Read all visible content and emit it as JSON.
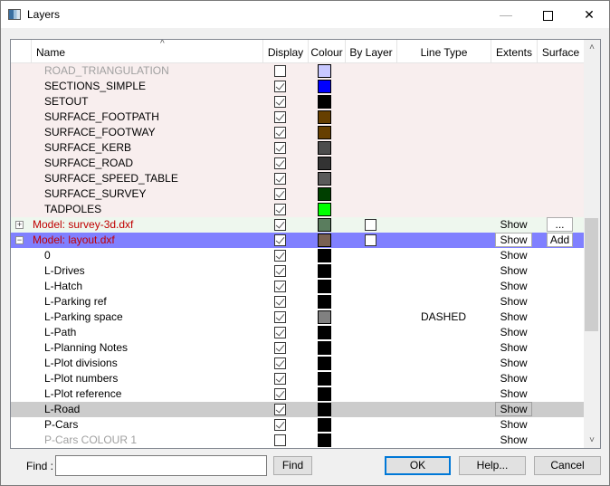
{
  "window": {
    "title": "Layers",
    "minimize_glyph": "—",
    "close_glyph": "✕",
    "app_icon": "layers-app-icon"
  },
  "columns": [
    {
      "key": "name",
      "label": "Name",
      "sorted": "ascending"
    },
    {
      "key": "display",
      "label": "Display"
    },
    {
      "key": "colour",
      "label": "Colour"
    },
    {
      "key": "bylayer",
      "label": "By Layer"
    },
    {
      "key": "linetype",
      "label": "Line Type"
    },
    {
      "key": "extents",
      "label": "Extents"
    },
    {
      "key": "surface",
      "label": "Surface"
    }
  ],
  "sort_glyph": "^",
  "rows": [
    {
      "type": "layer",
      "group": "pink",
      "name": "ROAD_TRIANGULATION",
      "dim": true,
      "display": false,
      "colour": "#c8c8ff"
    },
    {
      "type": "layer",
      "group": "pink",
      "name": "SECTIONS_SIMPLE",
      "display": true,
      "colour": "#0000ff"
    },
    {
      "type": "layer",
      "group": "pink",
      "name": "SETOUT",
      "display": true,
      "colour": "#000000"
    },
    {
      "type": "layer",
      "group": "pink",
      "name": "SURFACE_FOOTPATH",
      "display": true,
      "colour": "#663f00"
    },
    {
      "type": "layer",
      "group": "pink",
      "name": "SURFACE_FOOTWAY",
      "display": true,
      "colour": "#663f00"
    },
    {
      "type": "layer",
      "group": "pink",
      "name": "SURFACE_KERB",
      "display": true,
      "colour": "#4d4d4d"
    },
    {
      "type": "layer",
      "group": "pink",
      "name": "SURFACE_ROAD",
      "display": true,
      "colour": "#333333"
    },
    {
      "type": "layer",
      "group": "pink",
      "name": "SURFACE_SPEED_TABLE",
      "display": true,
      "colour": "#5a5a5a"
    },
    {
      "type": "layer",
      "group": "pink",
      "name": "SURFACE_SURVEY",
      "display": true,
      "colour": "#003f00"
    },
    {
      "type": "layer",
      "group": "pink",
      "name": "TADPOLES",
      "display": true,
      "colour": "#00ff00"
    },
    {
      "type": "model",
      "group": "green",
      "name": "Model: survey-3d.dxf",
      "expander": "+",
      "display": true,
      "colour": "#5a7d5e",
      "bylayer": false,
      "extents": "Show",
      "surface": "..."
    },
    {
      "type": "model",
      "group": "sel",
      "name": "Model: layout.dxf",
      "expander": "−",
      "display": true,
      "colour": "#7a6152",
      "bylayer": false,
      "extents": "Show",
      "extents_button": true,
      "surface": "Add"
    },
    {
      "type": "layer",
      "name": "0",
      "display": true,
      "colour": "#000000",
      "extents": "Show"
    },
    {
      "type": "layer",
      "name": "L-Drives",
      "display": true,
      "colour": "#000000",
      "extents": "Show"
    },
    {
      "type": "layer",
      "name": "L-Hatch",
      "display": true,
      "colour": "#000000",
      "extents": "Show"
    },
    {
      "type": "layer",
      "name": "L-Parking ref",
      "display": true,
      "colour": "#000000",
      "extents": "Show"
    },
    {
      "type": "layer",
      "name": "L-Parking space",
      "display": true,
      "colour": "#808080",
      "linetype": "DASHED",
      "extents": "Show"
    },
    {
      "type": "layer",
      "name": "L-Path",
      "display": true,
      "colour": "#000000",
      "extents": "Show"
    },
    {
      "type": "layer",
      "name": "L-Planning Notes",
      "display": true,
      "colour": "#000000",
      "extents": "Show"
    },
    {
      "type": "layer",
      "name": "L-Plot divisions",
      "display": true,
      "colour": "#000000",
      "extents": "Show"
    },
    {
      "type": "layer",
      "name": "L-Plot numbers",
      "display": true,
      "colour": "#000000",
      "extents": "Show"
    },
    {
      "type": "layer",
      "name": "L-Plot reference",
      "display": true,
      "colour": "#000000",
      "extents": "Show"
    },
    {
      "type": "layer",
      "group": "hl",
      "name": "L-Road",
      "display": true,
      "colour": "#000000",
      "extents": "Show",
      "extents_button": true
    },
    {
      "type": "layer",
      "name": "P-Cars",
      "display": true,
      "colour": "#000000",
      "extents": "Show"
    },
    {
      "type": "layer",
      "name": "P-Cars COLOUR 1",
      "dim": true,
      "display": false,
      "colour": "#000000",
      "extents": "Show"
    }
  ],
  "scrollbar": {
    "up_glyph": "˄",
    "down_glyph": "˅",
    "position_fraction": 0.44
  },
  "footer": {
    "find_label": "Find :",
    "find_value": "",
    "find_button": "Find",
    "ok_button": "OK",
    "help_button": "Help...",
    "cancel_button": "Cancel"
  }
}
